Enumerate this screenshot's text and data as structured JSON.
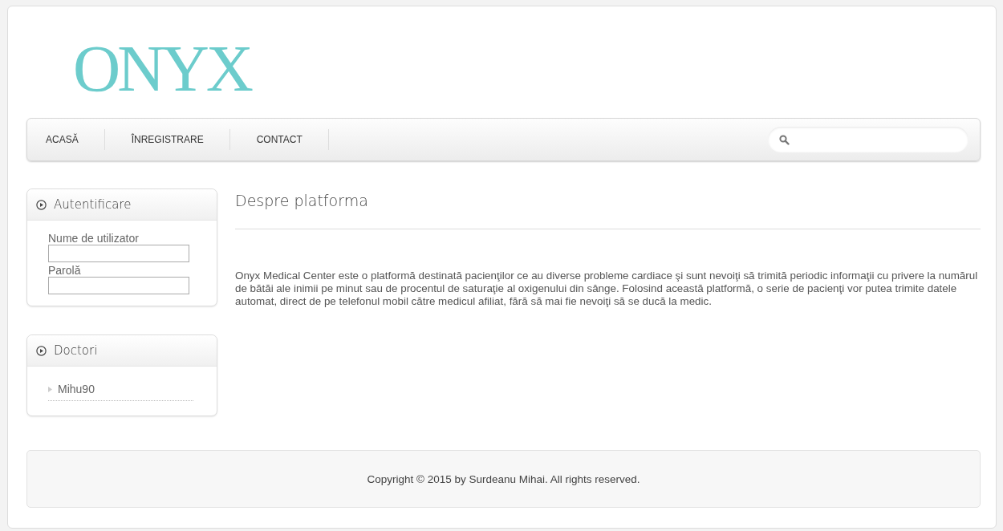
{
  "logo": "ONYX",
  "nav": {
    "items": [
      {
        "label": "ACASĂ"
      },
      {
        "label": "ÎNREGISTRARE"
      },
      {
        "label": "CONTACT"
      }
    ],
    "search": {
      "kind": "search"
    }
  },
  "sidebar": [
    {
      "title": "Autentificare",
      "kind": "login",
      "fields": [
        {
          "label": "Nume de utilizator"
        },
        {
          "label": "Parolă"
        }
      ]
    },
    {
      "title": "Doctori",
      "kind": "list",
      "items": [
        "Mihu90"
      ]
    }
  ],
  "content": {
    "title": "Despre platforma",
    "text": "Onyx Medical Center este o platformă destinată pacienţilor ce au diverse probleme cardiace şi sunt nevoiţi să trimită periodic informaţii cu privere la numărul de bătăi ale inimii pe minut sau de procentul de saturaţie al oxigenului din sânge. Folosind această platformă, o serie de pacienţi vor putea trimite datele automat, direct de pe telefonul mobil către medicul afiliat, fără să mai fie nevoiţi să se ducă la medic."
  },
  "footer": "Copyright © 2015 by Surdeanu Mihai. All rights reserved."
}
